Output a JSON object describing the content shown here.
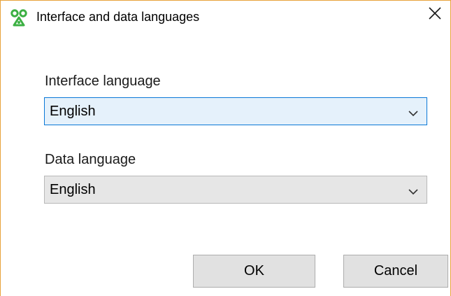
{
  "window": {
    "title": "Interface and data languages"
  },
  "icons": {
    "app": "app-icon",
    "close": "close-icon",
    "chevron": "chevron-down-icon"
  },
  "interface_language": {
    "label": "Interface language",
    "selected": "English"
  },
  "data_language": {
    "label": "Data language",
    "selected": "English"
  },
  "buttons": {
    "ok": "OK",
    "cancel": "Cancel"
  },
  "colors": {
    "window_border": "#e8a33a",
    "focus_border": "#0a78d7",
    "focus_fill": "#e5f1fb",
    "app_icon": "#3cb043"
  }
}
